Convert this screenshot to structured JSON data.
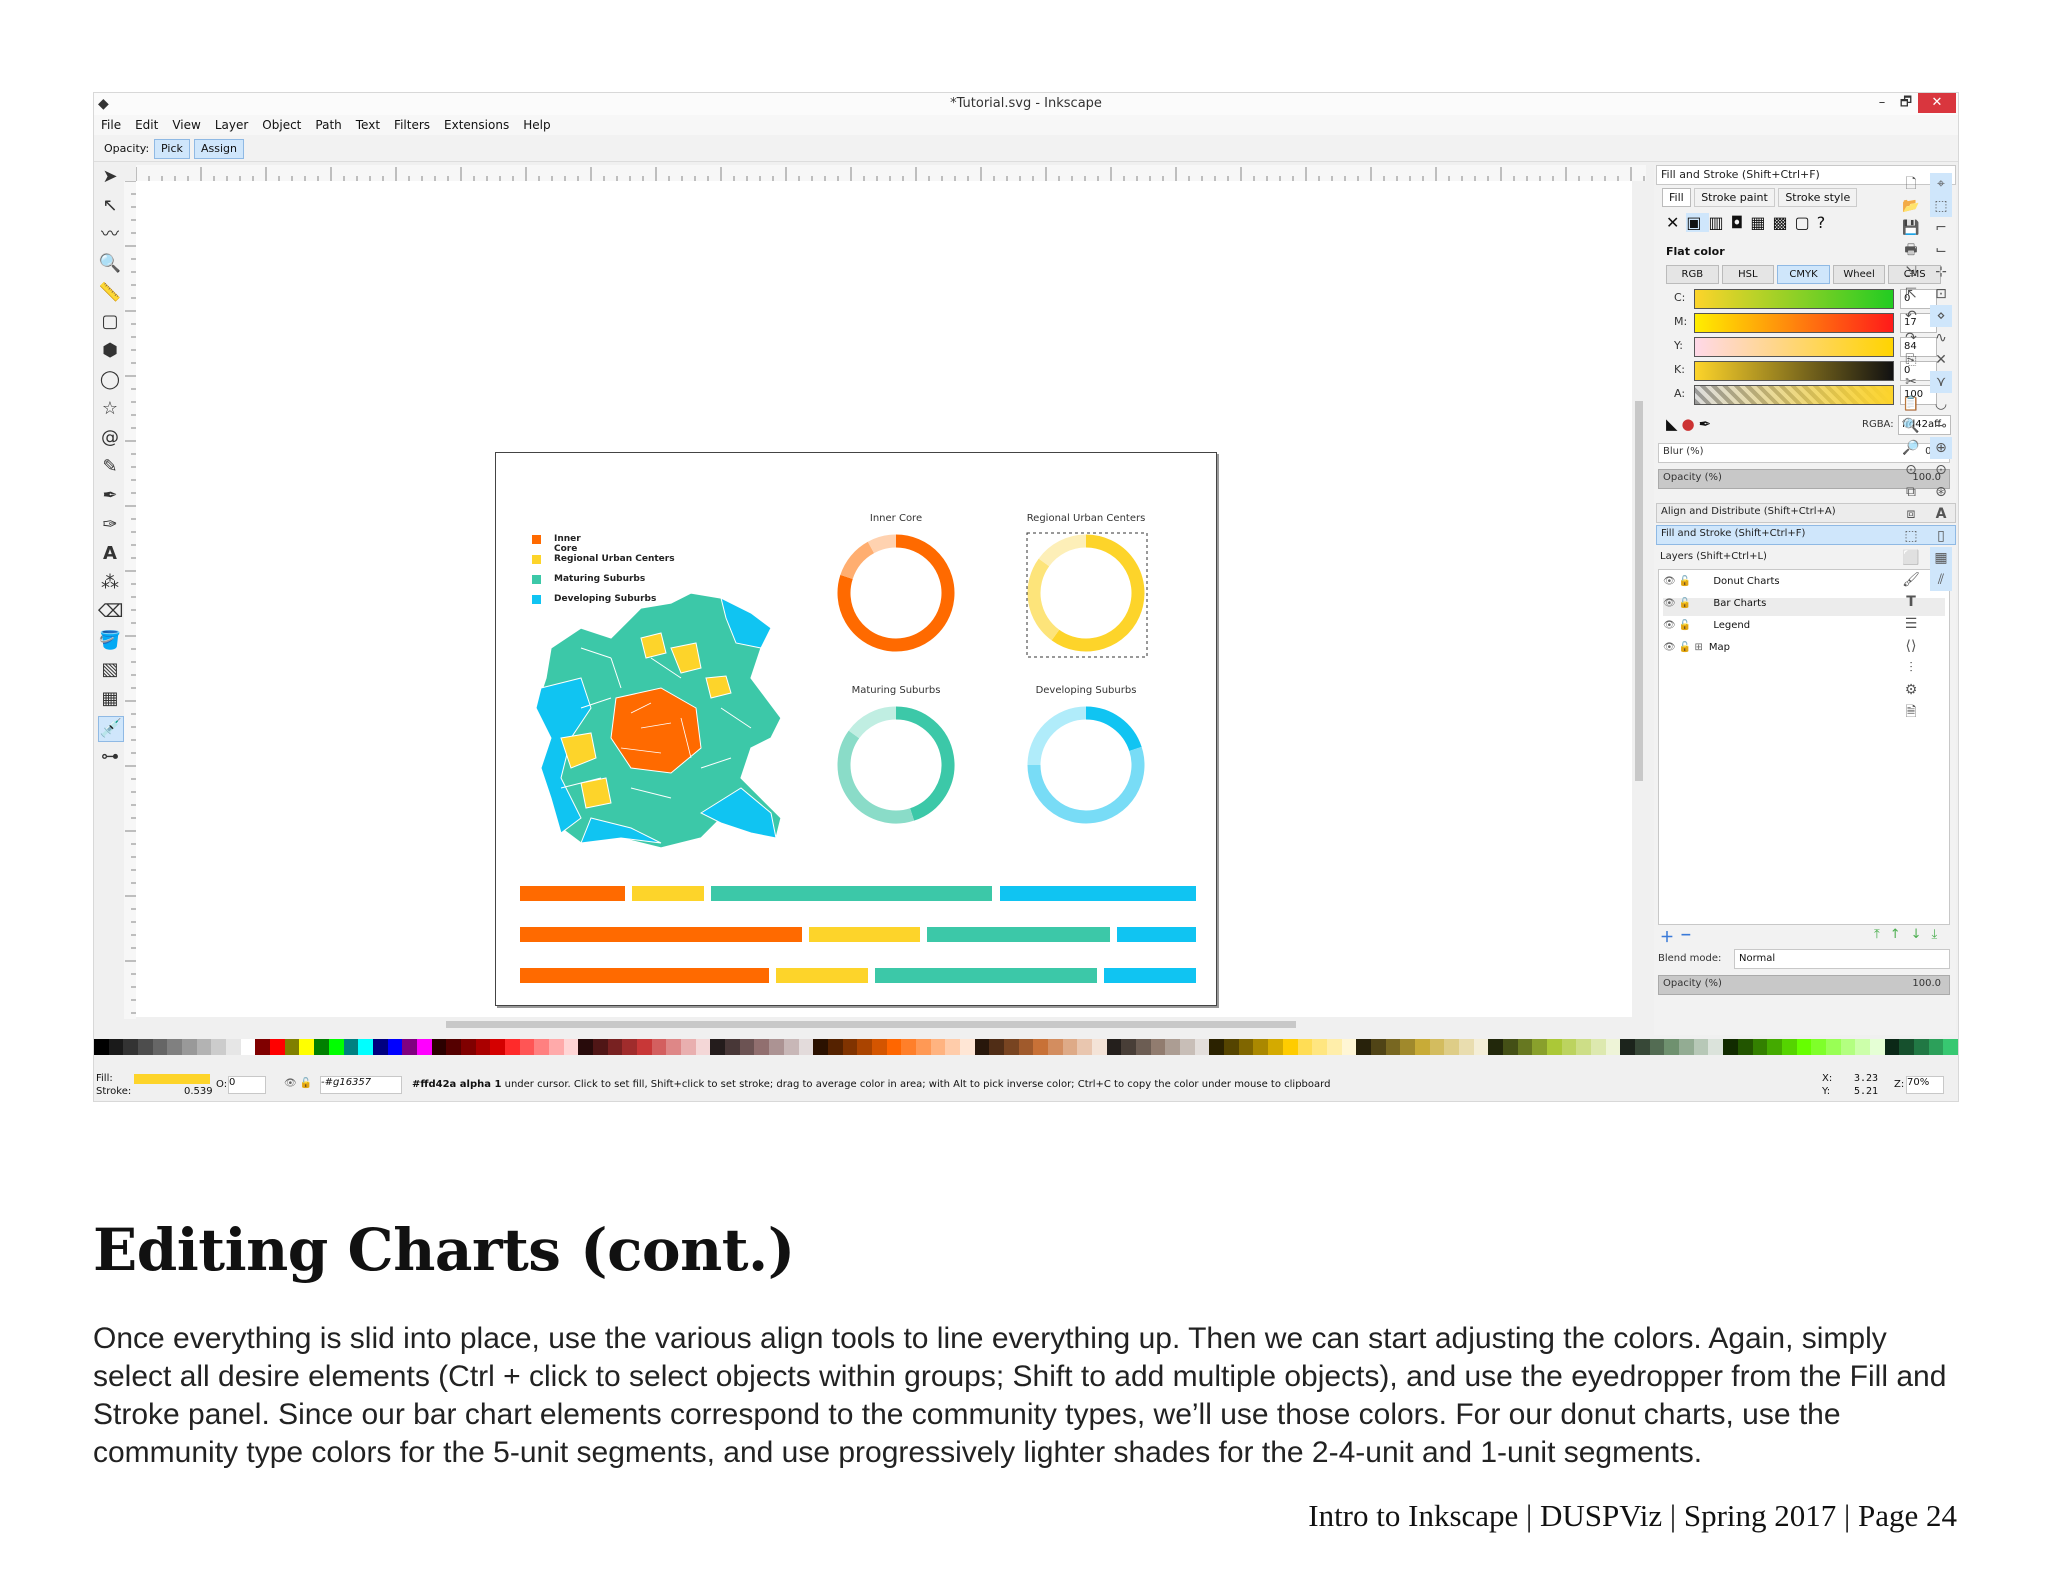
{
  "window": {
    "title": "*Tutorial.svg - Inkscape",
    "controls": [
      "–",
      "🗗",
      "✕"
    ]
  },
  "menu": [
    "File",
    "Edit",
    "View",
    "Layer",
    "Object",
    "Path",
    "Text",
    "Filters",
    "Extensions",
    "Help"
  ],
  "controlbar": {
    "opacity_label": "Opacity:",
    "pick": "Pick",
    "assign": "Assign"
  },
  "chart_data": {
    "type": "bar",
    "legend": [
      {
        "label": "Inner Core",
        "color": "#ff6a00"
      },
      {
        "label": "Regional Urban Centers",
        "color": "#fdd42a"
      },
      {
        "label": "Maturing Suburbs",
        "color": "#3cc8a8"
      },
      {
        "label": "Developing Suburbs",
        "color": "#10c4f2"
      }
    ],
    "donuts": [
      {
        "title": "Inner Core",
        "colors": [
          "#ff6a00",
          "#ffae70",
          "#ffd2b0"
        ],
        "values": [
          80,
          12,
          8
        ]
      },
      {
        "title": "Regional Urban Centers",
        "colors": [
          "#fdd42a",
          "#fde47a",
          "#fdefb8"
        ],
        "values": [
          60,
          25,
          15
        ]
      },
      {
        "title": "Maturing Suburbs",
        "colors": [
          "#3cc8a8",
          "#8adcc8",
          "#c0eee2"
        ],
        "values": [
          45,
          40,
          15
        ]
      },
      {
        "title": "Developing Suburbs",
        "colors": [
          "#10c4f2",
          "#78dcf6",
          "#b0ecfa"
        ],
        "values": [
          20,
          55,
          25
        ]
      }
    ],
    "bars": [
      [
        16,
        11,
        43,
        30
      ],
      [
        43,
        17,
        28,
        12
      ],
      [
        38,
        14,
        34,
        14
      ]
    ]
  },
  "panel": {
    "fill_stroke_title": "Fill and Stroke (Shift+Ctrl+F)",
    "tabs": [
      "Fill",
      "Stroke paint",
      "Stroke style"
    ],
    "flat_color": "Flat color",
    "modes": [
      "RGB",
      "HSL",
      "CMYK",
      "Wheel",
      "CMS"
    ],
    "channels": [
      {
        "label": "C:",
        "value": "0"
      },
      {
        "label": "M:",
        "value": "17"
      },
      {
        "label": "Y:",
        "value": "84"
      },
      {
        "label": "K:",
        "value": "0"
      },
      {
        "label": "A:",
        "value": "100"
      }
    ],
    "rgba_label": "RGBA:",
    "rgba_value": "ffd42aff",
    "blur_label": "Blur (%)",
    "blur_value": "0.0",
    "opacity_label": "Opacity (%)",
    "opacity_value": "100.0",
    "align_title": "Align and Distribute (Shift+Ctrl+A)",
    "fill_stroke_title2": "Fill and Stroke (Shift+Ctrl+F)",
    "layers_title": "Layers (Shift+Ctrl+L)",
    "layers": [
      "Donut Charts",
      "Bar Charts",
      "Legend",
      "Map"
    ],
    "blend_label": "Blend mode:",
    "blend_value": "Normal",
    "opacity2_label": "Opacity (%)",
    "opacity2_value": "100.0"
  },
  "status": {
    "fill_label": "Fill:",
    "stroke_label": "Stroke:",
    "stroke_value": "0.539",
    "o_label": "O:",
    "o_value": "0",
    "layer": "-#g16357",
    "message_bold1": "#ffd42a alpha 1",
    "message": " under cursor. Click to set fill, Shift+click to set stroke; drag to average color in area; with Alt to pick inverse color; Ctrl+C to copy the color under mouse to clipboard",
    "x_label": "X:",
    "x_value": "3.23",
    "y_label": "Y:",
    "y_value": "5.21",
    "z_label": "Z:",
    "zoom": "70%"
  },
  "colors": {
    "fill_swatch": "#fdd42a"
  },
  "doc": {
    "title": "Editing Charts (cont.)",
    "body": "Once everything is slid into place, use the various align tools to line everything up. Then we can start adjusting the colors. Again, simply select all desire elements (Ctrl + click to select objects within groups; Shift to add multiple objects), and use the eyedropper from the Fill and Stroke panel. Since our bar chart elements correspond to the community types, we’ll use those colors. For our donut charts, use the community type colors for the 5-unit segments, and use progressively lighter shades for the 2-4-unit and 1-unit segments.",
    "footer": "Intro to Inkscape | DUSPViz | Spring 2017 | Page 24"
  }
}
